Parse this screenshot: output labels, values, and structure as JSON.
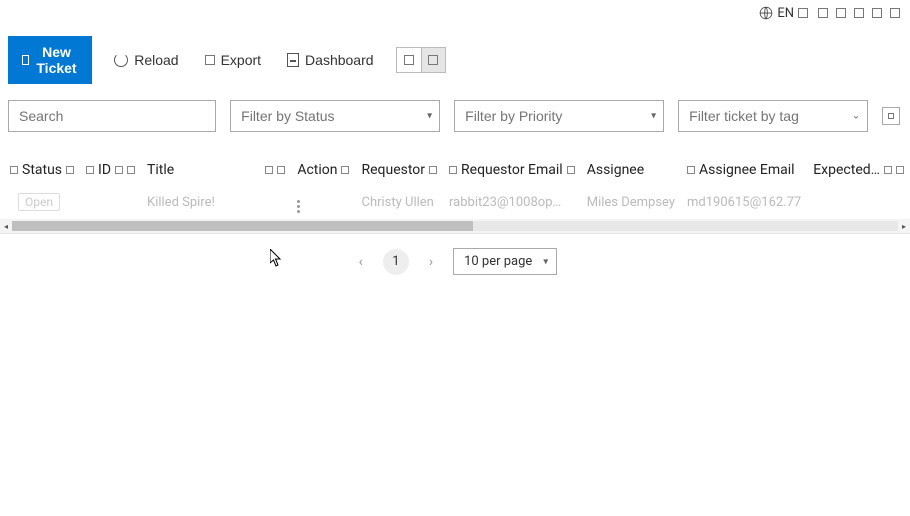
{
  "topbar": {
    "lang_label": "EN"
  },
  "toolbar": {
    "new_ticket": "New Ticket",
    "reload": "Reload",
    "export": "Export",
    "dashboard": "Dashboard"
  },
  "filters": {
    "search_placeholder": "Search",
    "status_placeholder": "Filter by Status",
    "priority_placeholder": "Filter by Priority",
    "tag_placeholder": "Filter ticket by tag"
  },
  "columns": {
    "status": "Status",
    "id": "ID",
    "title": "Title",
    "action": "Action",
    "requestor": "Requestor",
    "requestor_email": "Requestor Email",
    "assignee": "Assignee",
    "assignee_email": "Assignee Email",
    "expected": "Expected…"
  },
  "rows": [
    {
      "status": "Open",
      "id": "",
      "title": "Killed Spire!",
      "action": "",
      "requestor": "Christy Ullen",
      "requestor_email": "rabbit23@1008op…",
      "assignee": "Miles Dempsey",
      "assignee_email": "md190615@162.77",
      "expected": ""
    }
  ],
  "pagination": {
    "current": "1",
    "per_page": "10 per page"
  }
}
